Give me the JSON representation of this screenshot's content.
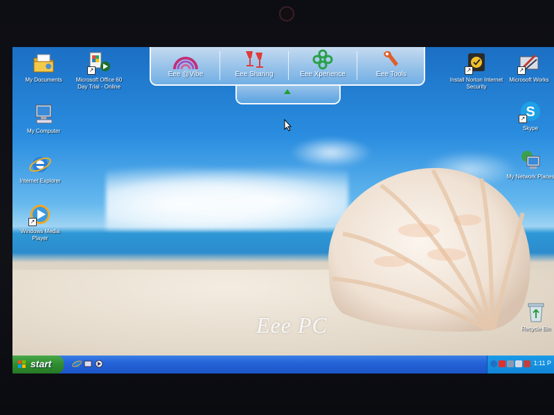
{
  "desktop": {
    "left_icons": [
      {
        "name": "my-documents",
        "label": "My Documents"
      },
      {
        "name": "microsoft-office",
        "label": "Microsoft Office 60 Day Trial - Online"
      },
      {
        "name": "my-computer",
        "label": "My Computer"
      },
      {
        "name": "internet-explorer",
        "label": "Internet Explorer"
      },
      {
        "name": "windows-media-player",
        "label": "Windows Media Player"
      }
    ],
    "right_icons": [
      {
        "name": "install-norton",
        "label": "Install Norton Internet Security"
      },
      {
        "name": "microsoft-works",
        "label": "Microsoft Works"
      },
      {
        "name": "skype",
        "label": "Skype"
      },
      {
        "name": "my-network-places",
        "label": "My Network Places"
      },
      {
        "name": "recycle-bin",
        "label": "Recycle Bin"
      }
    ],
    "wallpaper_brand": "Eee PC"
  },
  "dock": {
    "items": [
      {
        "label": "Eee @Vibe"
      },
      {
        "label": "Eee Sharing"
      },
      {
        "label": "Eee Xperience"
      },
      {
        "label": "Eee Tools"
      }
    ]
  },
  "taskbar": {
    "start_label": "start",
    "clock": "1:11 P",
    "colors": {
      "taskbar": "#2563d8",
      "start": "#2f8c2f",
      "tray": "#1285d6"
    }
  }
}
